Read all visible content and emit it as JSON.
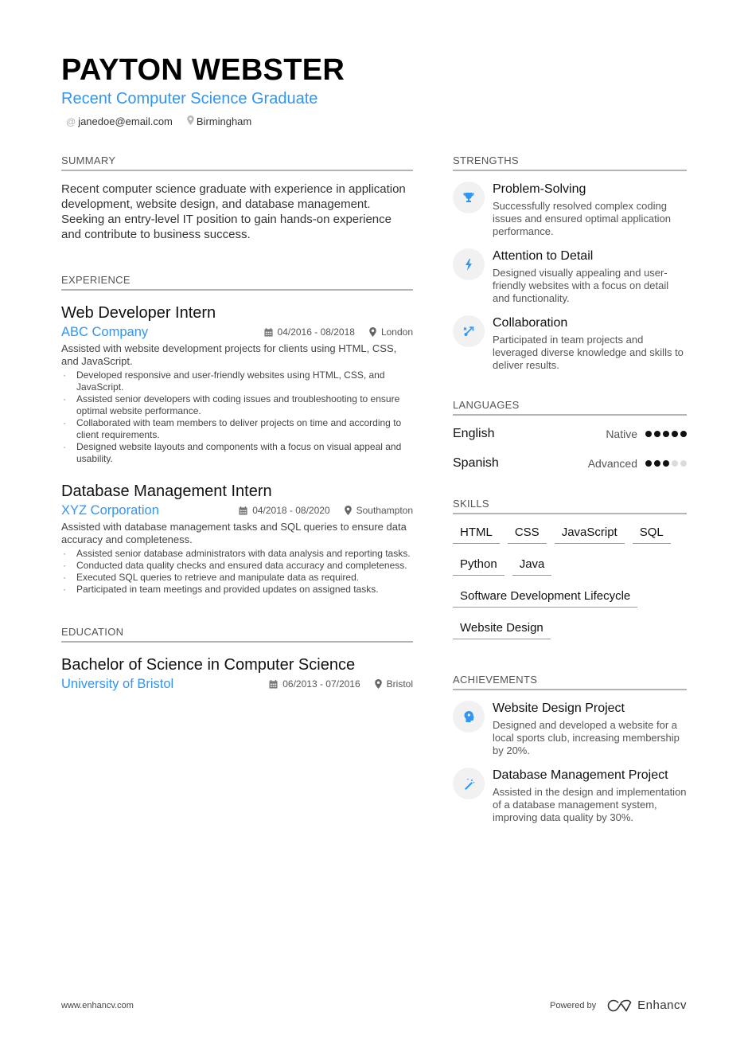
{
  "header": {
    "name": "PAYTON WEBSTER",
    "title": "Recent Computer Science Graduate",
    "email": "janedoe@email.com",
    "location": "Birmingham",
    "accent_color": "#2f96f4"
  },
  "summary": {
    "heading": "SUMMARY",
    "text": "Recent computer science graduate with experience in application development, website design, and database management. Seeking an entry-level IT position to gain hands-on experience and contribute to business success."
  },
  "experience": {
    "heading": "EXPERIENCE",
    "jobs": [
      {
        "title": "Web Developer Intern",
        "company": "ABC Company",
        "dates": "04/2016 - 08/2018",
        "location": "London",
        "description": "Assisted with website development projects for clients using HTML, CSS, and JavaScript.",
        "bullets": [
          "Developed responsive and user-friendly websites using HTML, CSS, and JavaScript.",
          "Assisted senior developers with coding issues and troubleshooting to ensure optimal website performance.",
          "Collaborated with team members to deliver projects on time and according to client requirements.",
          "Designed website layouts and components with a focus on visual appeal and usability."
        ]
      },
      {
        "title": "Database Management Intern",
        "company": "XYZ Corporation",
        "dates": "04/2018 - 08/2020",
        "location": "Southampton",
        "description": "Assisted with database management tasks and SQL queries to ensure data accuracy and completeness.",
        "bullets": [
          "Assisted senior database administrators with data analysis and reporting tasks.",
          "Conducted data quality checks and ensured data accuracy and completeness.",
          "Executed SQL queries to retrieve and manipulate data as required.",
          "Participated in team meetings and provided updates on assigned tasks."
        ]
      }
    ]
  },
  "education": {
    "heading": "EDUCATION",
    "items": [
      {
        "degree": "Bachelor of Science in Computer Science",
        "school": "University of Bristol",
        "dates": "06/2013 - 07/2016",
        "location": "Bristol"
      }
    ]
  },
  "strengths": {
    "heading": "STRENGTHS",
    "items": [
      {
        "icon": "trophy-icon",
        "title": "Problem-Solving",
        "description": "Successfully resolved complex coding issues and ensured optimal application performance."
      },
      {
        "icon": "lightning-bolt-icon",
        "title": "Attention to Detail",
        "description": "Designed visually appealing and user-friendly websites with a focus on detail and functionality."
      },
      {
        "icon": "route-arrow-icon",
        "title": "Collaboration",
        "description": "Participated in team projects and leveraged diverse knowledge and skills to deliver results."
      }
    ]
  },
  "languages": {
    "heading": "LANGUAGES",
    "items": [
      {
        "name": "English",
        "level": "Native",
        "rating": 5,
        "max": 5
      },
      {
        "name": "Spanish",
        "level": "Advanced",
        "rating": 3,
        "max": 5
      }
    ]
  },
  "skills": {
    "heading": "SKILLS",
    "items": [
      "HTML",
      "CSS",
      "JavaScript",
      "SQL",
      "Python",
      "Java",
      "Software Development Lifecycle",
      "Website Design"
    ]
  },
  "achievements": {
    "heading": "ACHIEVEMENTS",
    "items": [
      {
        "icon": "head-brain-icon",
        "title": "Website Design Project",
        "description": "Designed and developed a website for a local sports club, increasing membership by 20%."
      },
      {
        "icon": "magic-wand-icon",
        "title": "Database Management Project",
        "description": "Assisted in the design and implementation of a database management system, improving data quality by 30%."
      }
    ]
  },
  "footer": {
    "website": "www.enhancv.com",
    "powered_by": "Powered by",
    "brand": "Enhancv"
  }
}
